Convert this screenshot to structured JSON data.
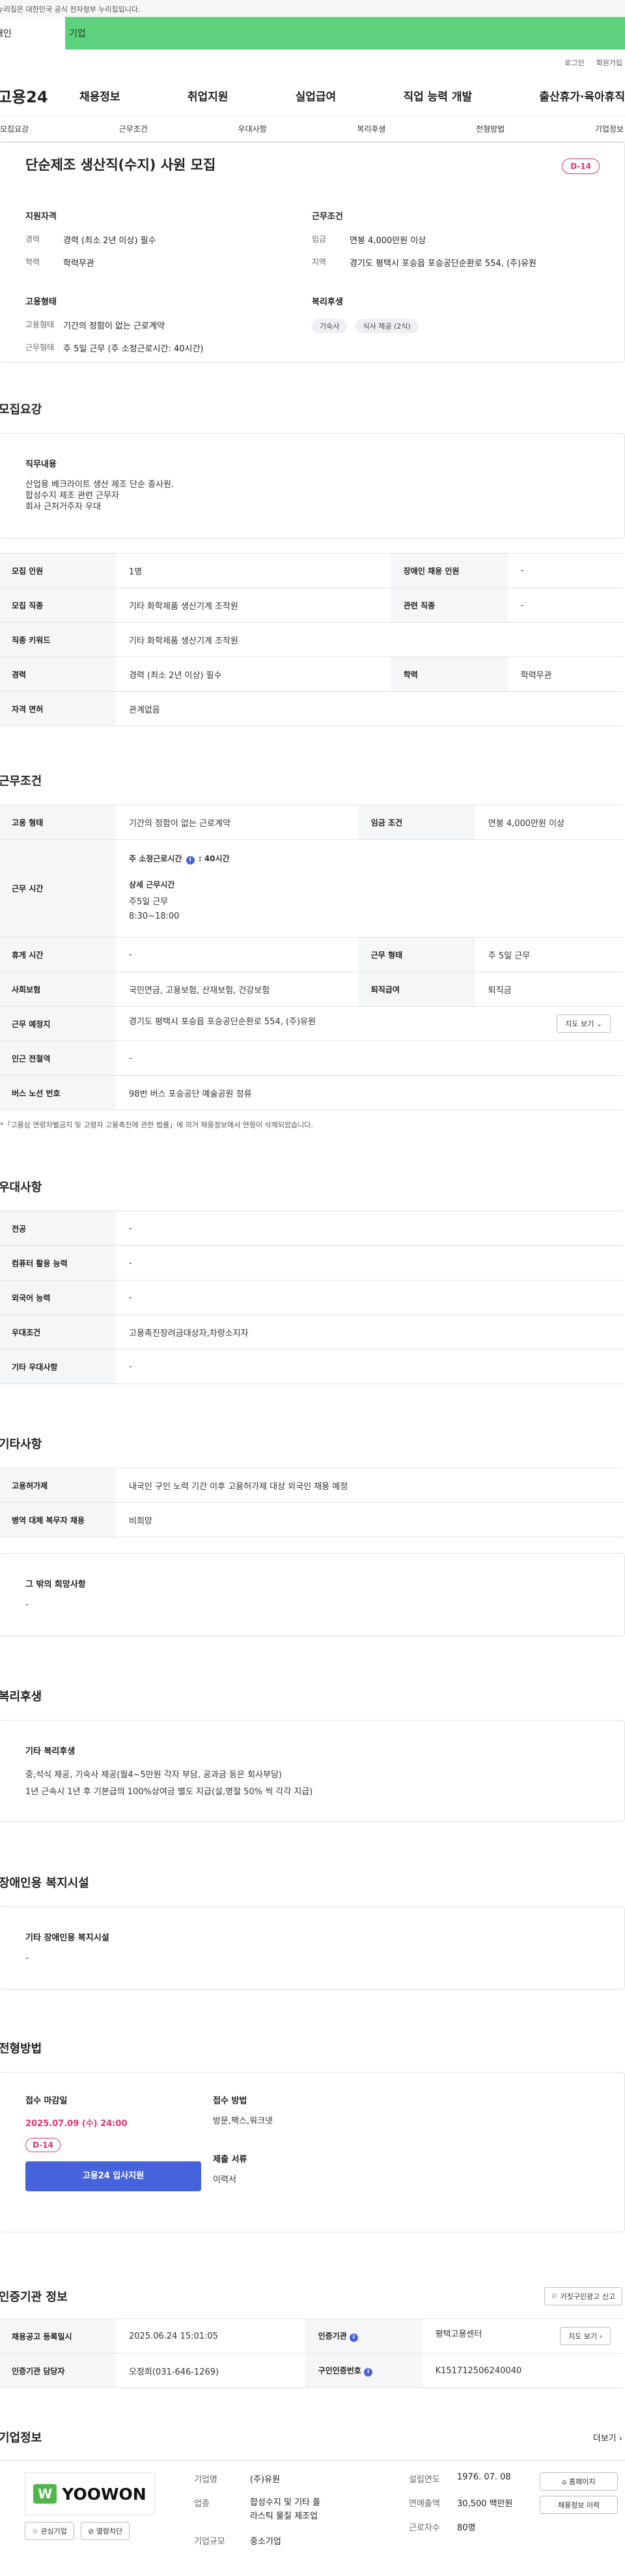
{
  "gov_notice": "이 누리집은 대한민국 공식 전자정부 누리집입니다.",
  "user_tabs": {
    "personal": "개인",
    "corp": "기업"
  },
  "util": {
    "login": "로그인",
    "join": "회원가입"
  },
  "logo": "고용24",
  "gnb": [
    "채용정보",
    "취업지원",
    "실업급여",
    "직업 능력 개발",
    "출산휴가·육아휴직"
  ],
  "anchor_tabs": [
    "모집요강",
    "근무조건",
    "우대사항",
    "복리후생",
    "전형방법",
    "기업정보"
  ],
  "summary": {
    "title": "단순제조 생산직(수지) 사원 모집",
    "dday": "D-14",
    "qual_title": "지원자격",
    "career_k": "경력",
    "career_v": "경력 (최소 2년 이상) 필수",
    "edu_k": "학력",
    "edu_v": "학력무관",
    "emp_title": "고용형태",
    "emp_k": "고용형태",
    "emp_v": "기간의 정함이 없는 근로계약",
    "form_k": "근무형태",
    "form_v": "주 5일 근무 (주 소정근로시간: 40시간)",
    "cond_title": "근무조건",
    "wage_k": "임금",
    "wage_v": "연봉 4,000만원 이상",
    "area_k": "지역",
    "area_v": "경기도 평택시 포승읍 포승공단순환로 554, (주)유원",
    "welfare_title": "복리후생",
    "welfare_chips": [
      "기숙사",
      "식사 제공 (2식)"
    ]
  },
  "recruit": {
    "title": "모집요강",
    "job_title": "직무내용",
    "job_lines": [
      "산업용 베크라이트 생산 제조 단순 종사원.",
      "합성수지 제조 관련 근무자",
      "회사 근처거주자 우대"
    ],
    "rows": [
      [
        "모집 인원",
        "1명",
        "장애인 채용 인원",
        "-"
      ],
      [
        "모집 직종",
        "기타 화학제품 생산기계 조작원",
        "관련 직종",
        "-"
      ],
      [
        "직종 키워드",
        "기타 화학제품 생산기계 조작원"
      ],
      [
        "경력",
        "경력 (최소 2년 이상) 필수",
        "학력",
        "학력무관"
      ],
      [
        "자격 면허",
        "관계없음"
      ]
    ]
  },
  "conditions": {
    "title": "근무조건",
    "emp_k": "고용 형태",
    "emp_v": "기간의 정함이 없는 근로계약",
    "wage_k": "임금 조건",
    "wage_v": "연봉 4,000만원 이상",
    "hours_k": "근무 시간",
    "hours_week": "주 소정근로시간",
    "hours_week_v": "40시간",
    "hours_detail_title": "상세 근무시간",
    "hours_detail": [
      "주5일 근무",
      "8:30~18:00"
    ],
    "rows": [
      [
        "휴게 시간",
        "-",
        "근무 형태",
        "주 5일 근무"
      ],
      [
        "사회보험",
        "국민연금, 고용보험, 산재보험, 건강보험",
        "퇴직급여",
        "퇴직금"
      ]
    ],
    "place_k": "근무 예정지",
    "place_v": "경기도 평택시 포승읍 포승공단순환로 554, (주)유원",
    "map_btn": "지도 보기",
    "subway_k": "인근 전철역",
    "subway_v": "-",
    "bus_k": "버스 노선 번호",
    "bus_v": "98번 버스 포승공단 예술공원 정류",
    "note": "*「고용상 연령차별금지 및 고령자 고용촉진에 관한 법률」에 의거 채용정보에서 연령이 삭제되었습니다."
  },
  "preference": {
    "title": "우대사항",
    "rows": [
      [
        "전공",
        "-"
      ],
      [
        "컴퓨터 활용 능력",
        "-"
      ],
      [
        "외국어 능력",
        "-"
      ],
      [
        "우대조건",
        "고용촉진장려금대상자,차량소지자"
      ],
      [
        "기타 우대사항",
        "-"
      ]
    ]
  },
  "etc": {
    "title": "기타사항",
    "rows": [
      [
        "고용허가제",
        "내국인 구인 노력 기간 이후 고용허가제 대상 외국인 채용 예정"
      ],
      [
        "병역 대체 복무자 채용",
        "비희망"
      ]
    ],
    "other_title": "그 밖의 희망사항",
    "other_v": "-"
  },
  "welfare": {
    "title": "복리후생",
    "box_title": "기타 복리후생",
    "lines": [
      "중,석식 제공, 기숙사 제공(월4~5만원 각자 부담, 공과금 등은 회사부담)",
      "1년 근속시 1년 후 기본급의 100%상여금 별도 지급(설,명절 50% 씩 각각 지급)"
    ]
  },
  "disability": {
    "title": "장애인용 복지시설",
    "box_title": "기타 장애인용 복지시설",
    "value": "-"
  },
  "selection": {
    "title": "전형방법",
    "deadline_title": "접수 마감일",
    "deadline": "2025.07.09 (수) 24:00",
    "dday": "D-14",
    "apply_btn": "고용24 입사지원",
    "method_title": "접수 방법",
    "method_v": "방문,팩스,워크넷",
    "docs_title": "제출 서류",
    "docs_v": "이력서"
  },
  "cert": {
    "title": "인증기관 정보",
    "report_btn": "거짓구인광고 신고",
    "rows": [
      [
        "채용공고 등록일시",
        "2025.06.24 15:01:05",
        "인증기관",
        "평택고용센터"
      ],
      [
        "인증기관 담당자",
        "오정희(031-646-1269)",
        "구인인증번호",
        "K151712506240040"
      ]
    ],
    "map_btn": "지도 보기"
  },
  "company": {
    "title": "기업정보",
    "more": "더보기",
    "logo_text": "YOOWON",
    "fav_btn": "관심기업",
    "block_btn": "열람차단",
    "name_k": "기업명",
    "name_v": "(주)유원",
    "biz_k": "업종",
    "biz_v": "합성수지 및 기타 플라스틱 물질 제조업",
    "size_k": "기업규모",
    "size_v": "중소기업",
    "year_k": "설립연도",
    "year_v": "1976. 07. 08",
    "sales_k": "연매출액",
    "sales_v": "30,500 백만원",
    "staff_k": "근로자수",
    "staff_v": "80명",
    "home_btn": "홈페이지",
    "history_btn": "채용정보 이력"
  },
  "colors": {
    "accent": "#4663dc",
    "dday": "#e2336b",
    "corp_tab": "#5fd27d"
  }
}
